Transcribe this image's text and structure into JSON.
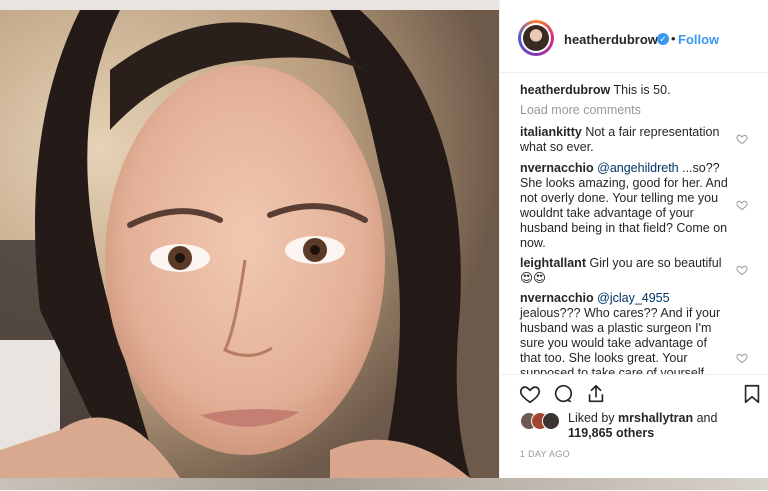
{
  "post": {
    "author": {
      "username": "heatherdubrow",
      "verified": true,
      "separator": "•",
      "follow_label": "Follow"
    },
    "caption": {
      "username": "heatherdubrow",
      "text": "This is 50."
    },
    "load_more_label": "Load more comments",
    "comments": [
      {
        "username": "italiankitty",
        "text": "Not a fair representation what so ever."
      },
      {
        "username": "nvernacchio",
        "mention": "@angehildreth",
        "text": "...so?? She looks amazing, good for her. And not overly done. Your telling me you wouldnt take advantage of your husband being in that field? Come on now."
      },
      {
        "username": "leightallant",
        "text": "Girl you are so beautiful 😍😍"
      },
      {
        "username": "nvernacchio",
        "mention": "@jclay_4955",
        "text": "jealous??? Who cares?? And if your husband was a plastic surgeon I'm sure you would take advantage of that too. She looks great. Your supposed to take care of yourself when you age"
      }
    ],
    "likes": {
      "prefix": "Liked by",
      "first_user": "mrshallytran",
      "joiner": "and",
      "count_text": "119,865 others"
    },
    "timestamp": "1 DAY AGO"
  },
  "icons": {
    "like": "heart-icon",
    "comment": "comment-icon",
    "share": "share-icon",
    "save": "bookmark-icon",
    "verified": "verified-badge-icon",
    "comment_like": "heart-small-icon"
  },
  "colors": {
    "link": "#3897f0",
    "text": "#262626",
    "muted": "#999999",
    "mention": "#003569"
  }
}
